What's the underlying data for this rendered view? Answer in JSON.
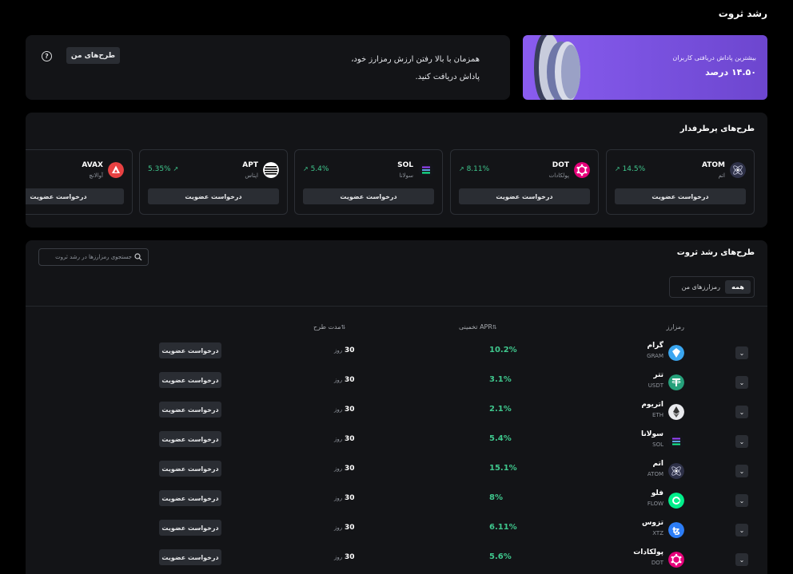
{
  "page_title": "رشد ثروت",
  "info_card": {
    "text_line1": "همزمان با بالا رفتن ارزش رمزارز خود،",
    "text_line2": "پاداش دریافت کنید.",
    "my_plans_button": "طرح‌های من",
    "help_icon": "question-circle-icon"
  },
  "promo": {
    "line1": "بیشترین پاداش دریافتی کاربران",
    "line2": "۱۴.۵۰ درصد"
  },
  "popular": {
    "title": "طرح‌های پرطرفدار",
    "cards": [
      {
        "symbol": "ATOM",
        "name": "اتم",
        "apr": "14.5%",
        "button": "درخواست عضویت",
        "icon": "atom-icon",
        "color": "#2e3148"
      },
      {
        "symbol": "DOT",
        "name": "پولکادات",
        "apr": "8.11%",
        "button": "درخواست عضویت",
        "icon": "polkadot-icon",
        "color": "#e6007a"
      },
      {
        "symbol": "SOL",
        "name": "سولانا",
        "apr": "5.4%",
        "button": "درخواست عضویت",
        "icon": "solana-icon",
        "color": "#14151a"
      },
      {
        "symbol": "APT",
        "name": "اپتاس",
        "apr": "5.35%",
        "button": "درخواست عضویت",
        "icon": "aptos-icon",
        "color": "#ffffff"
      },
      {
        "symbol": "AVAX",
        "name": "آوالانچ",
        "apr": "",
        "button": "درخواست عضویت",
        "icon": "avalanche-icon",
        "color": "#e84142"
      }
    ]
  },
  "table": {
    "title": "طرح‌های رشد ثروت",
    "search_placeholder": "جستجوی رمزارزها در رشد ثروت",
    "filter_all": "همه",
    "filter_mine": "رمزارزهای من",
    "col_coin": "رمزارز",
    "col_apr": "APR تخمینی",
    "col_duration": "مدت طرح",
    "rows": [
      {
        "name": "گرام",
        "symbol": "GRAM",
        "apr": "10.2%",
        "days": "30",
        "unit": "روز",
        "button": "درخواست عضویت",
        "icon": "gram-icon",
        "color": "#3aa6f0"
      },
      {
        "name": "تتر",
        "symbol": "USDT",
        "apr": "3.1%",
        "days": "30",
        "unit": "روز",
        "button": "درخواست عضویت",
        "icon": "tether-icon",
        "color": "#26a17b"
      },
      {
        "name": "اتریوم",
        "symbol": "ETH",
        "apr": "2.1%",
        "days": "30",
        "unit": "روز",
        "button": "درخواست عضویت",
        "icon": "ethereum-icon",
        "color": "#e9eaee"
      },
      {
        "name": "سولانا",
        "symbol": "SOL",
        "apr": "5.4%",
        "days": "30",
        "unit": "روز",
        "button": "درخواست عضویت",
        "icon": "solana-icon",
        "color": "#14151a"
      },
      {
        "name": "اتم",
        "symbol": "ATOM",
        "apr": "15.1%",
        "days": "30",
        "unit": "روز",
        "button": "درخواست عضویت",
        "icon": "atom-icon",
        "color": "#2e3148"
      },
      {
        "name": "فلو",
        "symbol": "FLOW",
        "apr": "8%",
        "days": "30",
        "unit": "روز",
        "button": "درخواست عضویت",
        "icon": "flow-icon",
        "color": "#00ef8b"
      },
      {
        "name": "تزوس",
        "symbol": "XTZ",
        "apr": "6.11%",
        "days": "30",
        "unit": "روز",
        "button": "درخواست عضویت",
        "icon": "tezos-icon",
        "color": "#2c7df7"
      },
      {
        "name": "پولکادات",
        "symbol": "DOT",
        "apr": "5.6%",
        "days": "30",
        "unit": "روز",
        "button": "درخواست عضویت",
        "icon": "polkadot-icon",
        "color": "#e6007a"
      }
    ]
  },
  "colors": {
    "accent_green": "#3fc78d",
    "promo_purple": "#8a5cf0",
    "card_bg": "#131417"
  }
}
